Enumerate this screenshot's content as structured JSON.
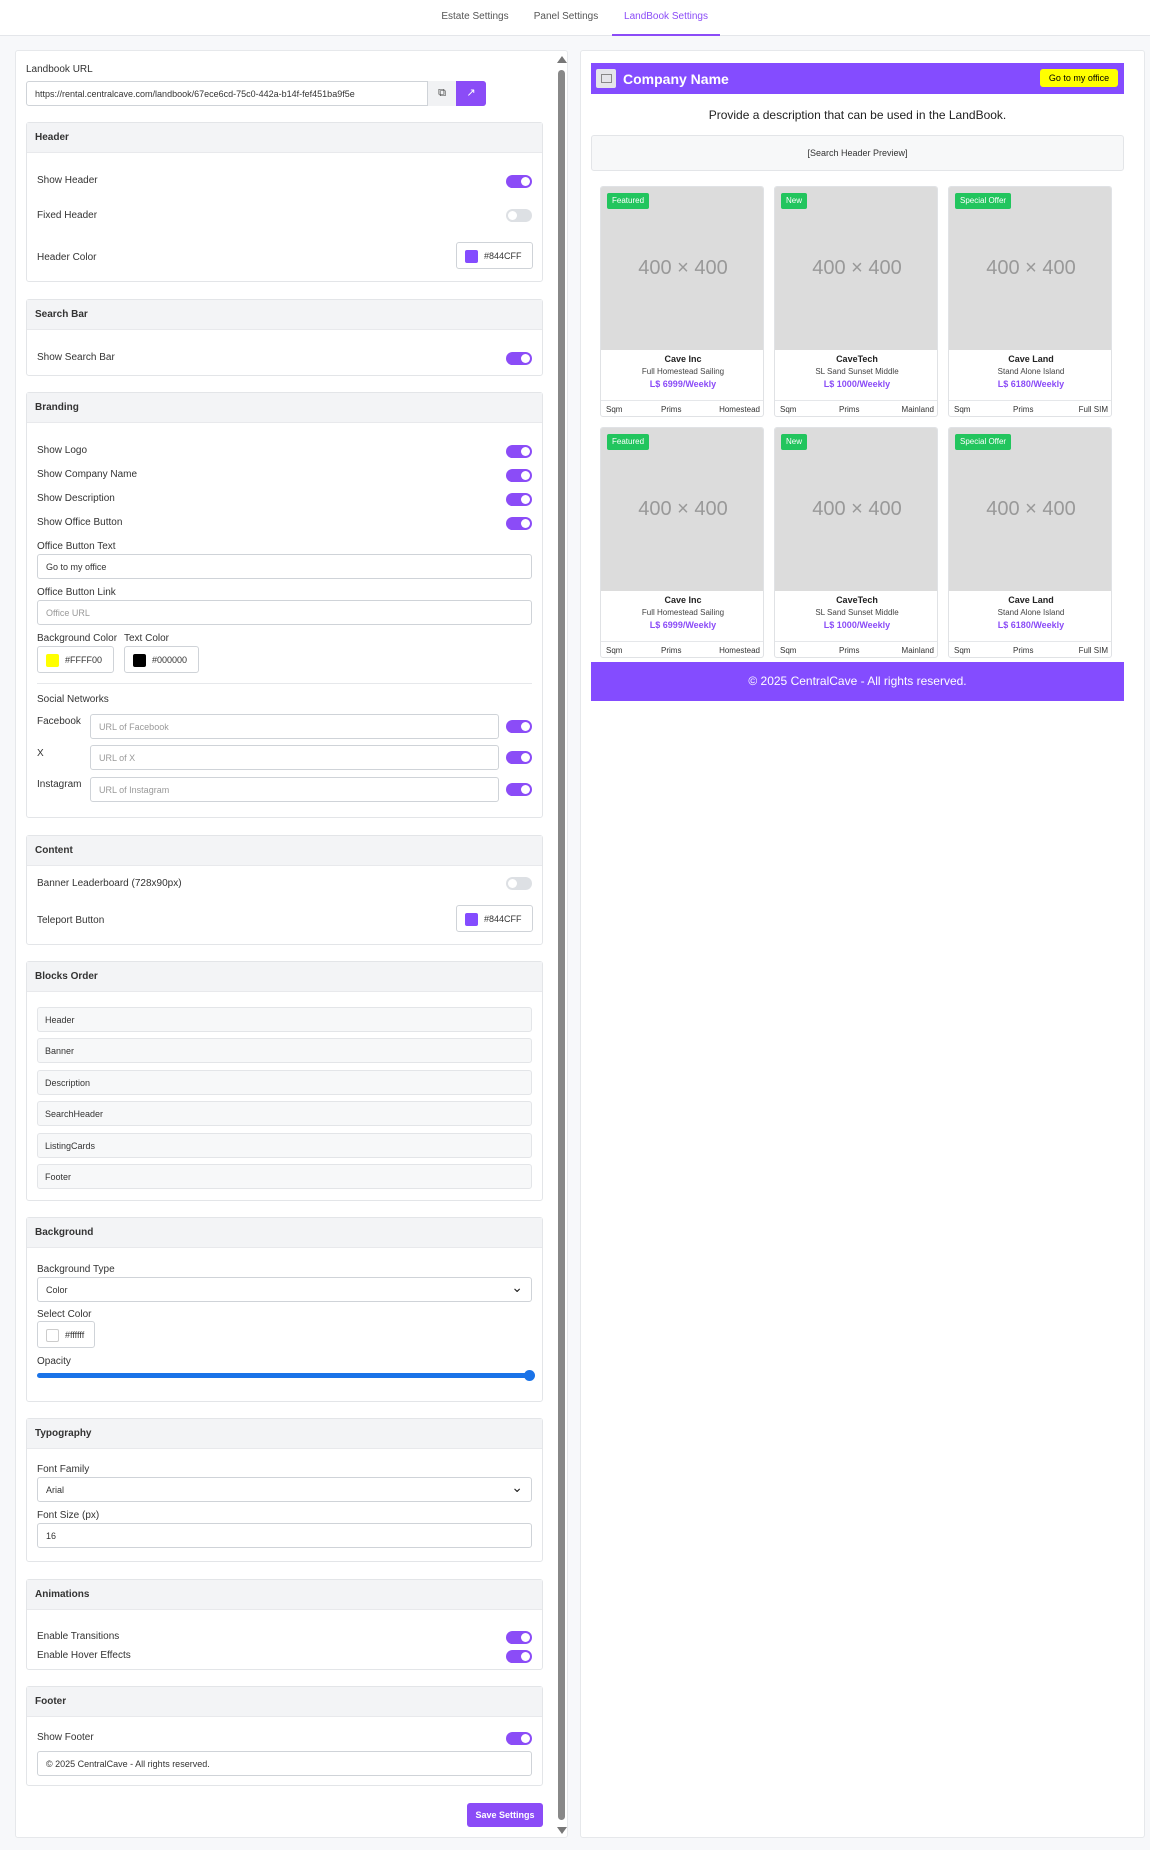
{
  "tabs": [
    "Estate Settings",
    "Panel Settings",
    "LandBook Settings"
  ],
  "url_section": {
    "label": "Landbook URL",
    "value": "https://rental.centralcave.com/landbook/67ece6cd-75c0-442a-b14f-fef451ba9f5e",
    "copy_icon": "copy-icon",
    "open_icon": "external-link-icon"
  },
  "header_card": {
    "title": "Header",
    "show_header": "Show Header",
    "fixed_header": "Fixed Header",
    "header_color": "Header Color",
    "header_color_value": "#844CFF"
  },
  "search_card": {
    "title": "Search Bar",
    "show_search": "Show Search Bar"
  },
  "branding_card": {
    "title": "Branding",
    "show_logo": "Show Logo",
    "show_company": "Show Company Name",
    "show_description": "Show Description",
    "show_office_button": "Show Office Button",
    "office_text_label": "Office Button Text",
    "office_text_value": "Go to my office",
    "office_link_label": "Office Button Link",
    "office_link_placeholder": "Office URL",
    "bg_color_label": "Background Color",
    "bg_color_value": "#FFFF00",
    "text_color_label": "Text Color",
    "text_color_value": "#000000",
    "social_label": "Social Networks",
    "facebook_label": "Facebook",
    "facebook_placeholder": "URL of Facebook",
    "x_label": "X",
    "x_placeholder": "URL of X",
    "instagram_label": "Instagram",
    "instagram_placeholder": "URL of Instagram"
  },
  "content_card": {
    "title": "Content",
    "banner": "Banner Leaderboard (728x90px)",
    "teleport": "Teleport Button",
    "teleport_color_value": "#844CFF"
  },
  "blocks_card": {
    "title": "Blocks Order",
    "items": [
      "Header",
      "Banner",
      "Description",
      "SearchHeader",
      "ListingCards",
      "Footer"
    ]
  },
  "background_card": {
    "title": "Background",
    "type_label": "Background Type",
    "type_value": "Color",
    "color_label": "Select Color",
    "color_value": "#ffffff",
    "opacity_label": "Opacity",
    "opacity": 1.0
  },
  "typography_card": {
    "title": "Typography",
    "family_label": "Font Family",
    "family_value": "Arial",
    "size_label": "Font Size (px)",
    "size_value": "16"
  },
  "animations_card": {
    "title": "Animations",
    "transitions": "Enable Transitions",
    "hover": "Enable Hover Effects"
  },
  "footer_card": {
    "title": "Footer",
    "show_footer": "Show Footer",
    "footer_text": "© 2025 CentralCave - All rights reserved."
  },
  "save_label": "Save Settings",
  "preview": {
    "company": "Company Name",
    "office_button": "Go to my office",
    "description": "Provide a description that can be used in the LandBook.",
    "search_preview": "[Search Header Preview]",
    "footer": "© 2025 CentralCave - All rights reserved.",
    "listings": [
      {
        "badge": "Featured",
        "placeholder": "400 × 400",
        "name": "Cave Inc",
        "sub": "Full Homestead Sailing",
        "price": "L$ 6999/Weekly",
        "f1": "Sqm",
        "f2": "Prims",
        "f3": "Homestead"
      },
      {
        "badge": "New",
        "placeholder": "400 × 400",
        "name": "CaveTech",
        "sub": "SL Sand Sunset Middle",
        "price": "L$ 1000/Weekly",
        "f1": "Sqm",
        "f2": "Prims",
        "f3": "Mainland"
      },
      {
        "badge": "Special Offer",
        "placeholder": "400 × 400",
        "name": "Cave Land",
        "sub": "Stand Alone Island",
        "price": "L$ 6180/Weekly",
        "f1": "Sqm",
        "f2": "Prims",
        "f3": "Full SIM"
      },
      {
        "badge": "Featured",
        "placeholder": "400 × 400",
        "name": "Cave Inc",
        "sub": "Full Homestead Sailing",
        "price": "L$ 6999/Weekly",
        "f1": "Sqm",
        "f2": "Prims",
        "f3": "Homestead"
      },
      {
        "badge": "New",
        "placeholder": "400 × 400",
        "name": "CaveTech",
        "sub": "SL Sand Sunset Middle",
        "price": "L$ 1000/Weekly",
        "f1": "Sqm",
        "f2": "Prims",
        "f3": "Mainland"
      },
      {
        "badge": "Special Offer",
        "placeholder": "400 × 400",
        "name": "Cave Land",
        "sub": "Stand Alone Island",
        "price": "L$ 6180/Weekly",
        "f1": "Sqm",
        "f2": "Prims",
        "f3": "Full SIM"
      }
    ]
  },
  "colors": {
    "accent": "#844CFF",
    "badge_green": "#22C55E",
    "office_yellow": "#FFFF00"
  }
}
